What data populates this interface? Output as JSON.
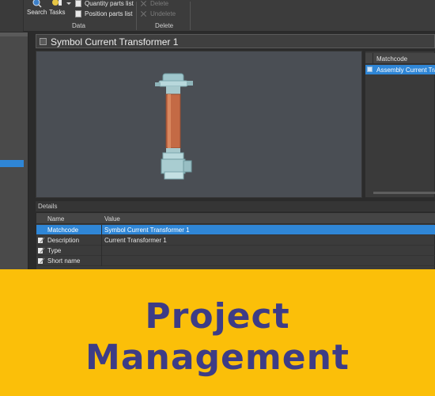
{
  "ribbon": {
    "search_label": "Search",
    "tasks_label": "Tasks",
    "quantity_parts_list": "Quantity parts list",
    "position_parts_list": "Position parts list",
    "delete_label": "Delete",
    "undelete_label": "Undelete",
    "data_group": "Data",
    "delete_group": "Delete"
  },
  "window": {
    "title": "Symbol Current Transformer 1"
  },
  "right_list": {
    "header": "Matchcode",
    "rows": [
      "Assembly Current Tra"
    ]
  },
  "details": {
    "label": "Details",
    "headers": {
      "name": "Name",
      "value": "Value"
    },
    "rows": [
      {
        "name": "Matchcode",
        "value": "Symbol Current Transformer 1",
        "selected": true
      },
      {
        "name": "Description",
        "value": "Current Transformer 1",
        "selected": false
      },
      {
        "name": "Type",
        "value": "",
        "selected": false
      },
      {
        "name": "Short name",
        "value": "",
        "selected": false
      }
    ]
  },
  "banner": {
    "line1": "Project",
    "line2": "Management"
  },
  "colors": {
    "banner_bg": "#fbbf09",
    "banner_text": "#3d3c86",
    "selection": "#2f86d6"
  }
}
